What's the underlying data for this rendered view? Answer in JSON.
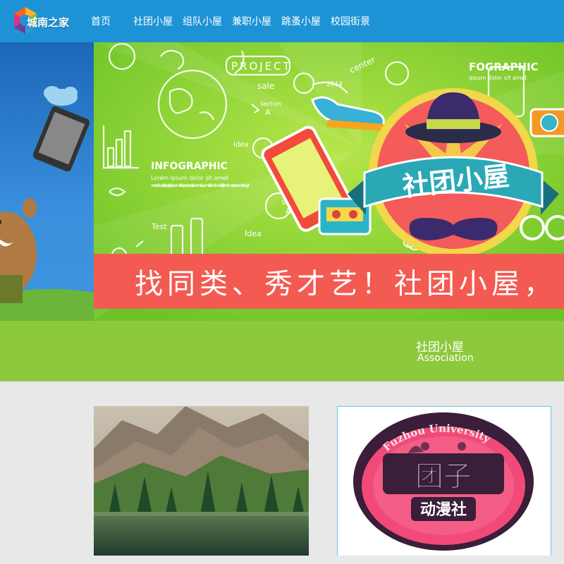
{
  "site": {
    "logo_text": "城南之家",
    "brand_color": "#1d93d5"
  },
  "nav": {
    "items": [
      {
        "label": "首页"
      },
      {
        "label": "社团小屋"
      },
      {
        "label": "组队小屋"
      },
      {
        "label": "兼职小屋"
      },
      {
        "label": "跳蚤小屋"
      },
      {
        "label": "校园街景"
      }
    ]
  },
  "banner": {
    "headline": "社团小屋",
    "project_word": "PROJECT",
    "sale_word": "sale",
    "center_word": "center",
    "year_word": "2014",
    "section_word": "Section",
    "section_letter": "A",
    "idea_word": "Idea",
    "test_word": "Test",
    "infographic": "INFOGRAPHIC",
    "infographic_sub": "Lorem ipsum dolor sit amet",
    "infographic_body": "consectetur adipiscing elit, quisque molestie posuere nisi, et venenatis quam eleifend ut, nunc fringilla lectus in massa euismod feugiat.",
    "infographic_right": "FOGRAPHIC",
    "infographic_right_sub": "ipsum dolor sit amet",
    "slogan": "找同类、秀才艺！社团小屋，"
  },
  "section": {
    "title": "社团小屋",
    "subtitle": "Association"
  },
  "cards": [
    {
      "kind": "landscape-photo"
    },
    {
      "kind": "club-logo",
      "arc_text": "Fuzhou University",
      "main_text": "团子",
      "sub_text": "动漫社"
    }
  ],
  "colors": {
    "banner_green": "#8bd634",
    "slogan_red": "#f35a52",
    "section_green": "#8dc93c",
    "page_bg": "#e8e8e8"
  }
}
